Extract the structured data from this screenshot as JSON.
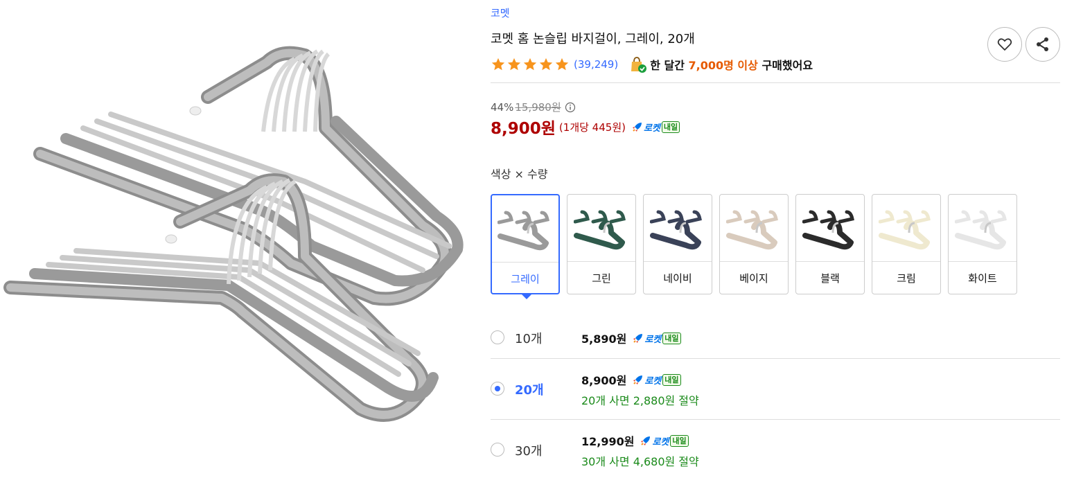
{
  "product": {
    "brand": "코멧",
    "title": "코멧 홈 논슬립 바지걸이, 그레이, 20개",
    "review_count": "(39,249)",
    "purchase_prefix": "한 달간",
    "purchase_highlight": "7,000명 이상",
    "purchase_suffix": "구매했어요",
    "rating_stars": 5
  },
  "price": {
    "discount_rate": "44%",
    "original_price": "15,980원",
    "sale_price": "8,900원",
    "unit_price": "(1개당 445원)"
  },
  "rocket": {
    "text": "로켓",
    "badge": "내일"
  },
  "options": {
    "label": "색상 × 수량",
    "colors": [
      {
        "label": "그레이",
        "color": "#9a9a9a",
        "selected": true
      },
      {
        "label": "그린",
        "color": "#2f5a4c",
        "selected": false
      },
      {
        "label": "네이비",
        "color": "#3a4258",
        "selected": false
      },
      {
        "label": "베이지",
        "color": "#d9cbbd",
        "selected": false
      },
      {
        "label": "블랙",
        "color": "#2b2b2b",
        "selected": false
      },
      {
        "label": "크림",
        "color": "#efe9cf",
        "selected": false
      },
      {
        "label": "화이트",
        "color": "#e6e6e6",
        "selected": false
      }
    ],
    "quantities": [
      {
        "label": "10개",
        "price": "5,890원",
        "saving": "",
        "selected": false
      },
      {
        "label": "20개",
        "price": "8,900원",
        "saving": "20개 사면 2,880원 절약",
        "selected": true
      },
      {
        "label": "30개",
        "price": "12,990원",
        "saving": "30개 사면 4,680원 절약",
        "selected": false
      }
    ]
  },
  "colors": {
    "accent": "#346aff",
    "price_red": "#ae0000",
    "rocket_blue": "#0073e9",
    "saving_green": "#1a8a1a",
    "star_orange": "#f7941d"
  }
}
